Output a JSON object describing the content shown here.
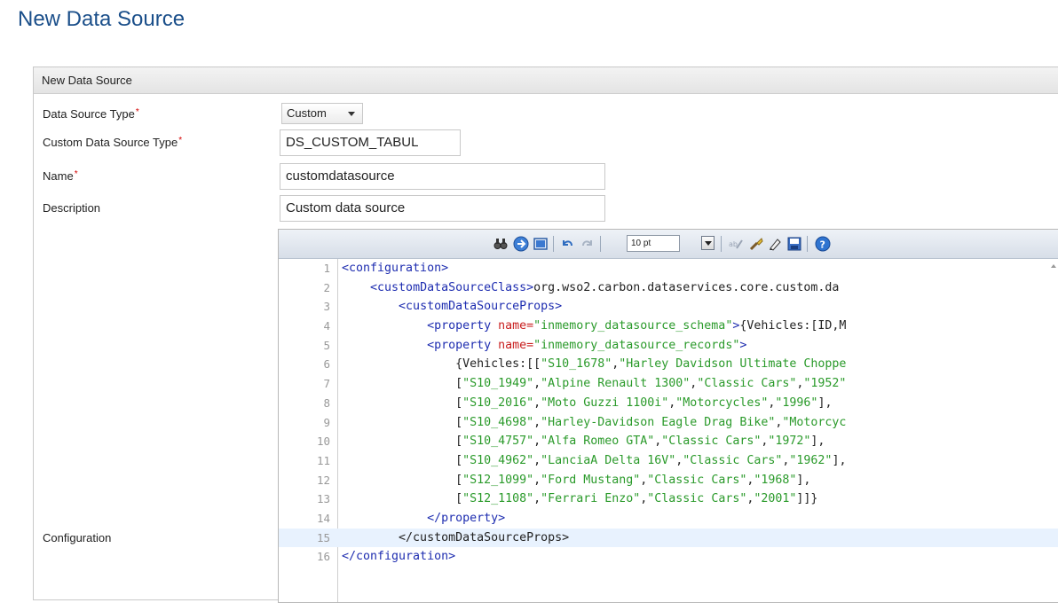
{
  "page_title": "New Data Source",
  "panel": {
    "header": "New Data Source",
    "required_marker": "*",
    "fields": {
      "type": {
        "label": "Data Source Type",
        "value": "Custom"
      },
      "custom_type": {
        "label": "Custom Data Source Type",
        "value": "DS_CUSTOM_TABUL"
      },
      "name": {
        "label": "Name",
        "value": "customdatasource"
      },
      "description": {
        "label": "Description",
        "value": "Custom data source"
      },
      "configuration": {
        "label": "Configuration"
      }
    }
  },
  "editor": {
    "font_size": "10 pt",
    "toolbar_icons": [
      "search-icon",
      "goto-icon",
      "fullscreen-icon",
      "undo-icon",
      "redo-icon",
      "font-size-select",
      "autocomplete-icon",
      "reformat-icon",
      "highlight-icon",
      "save-icon",
      "help-icon"
    ],
    "lines": [
      {
        "num": "1",
        "tokens": [
          {
            "t": "<configuration>",
            "c": "tag"
          }
        ]
      },
      {
        "num": "2",
        "tokens": [
          {
            "t": "    ",
            "c": "txt"
          },
          {
            "t": "<customDataSourceClass>",
            "c": "tag"
          },
          {
            "t": "org.wso2.carbon.dataservices.core.custom.da",
            "c": "txt"
          }
        ]
      },
      {
        "num": "3",
        "tokens": [
          {
            "t": "        ",
            "c": "txt"
          },
          {
            "t": "<customDataSourceProps>",
            "c": "tag"
          }
        ]
      },
      {
        "num": "4",
        "tokens": [
          {
            "t": "            ",
            "c": "txt"
          },
          {
            "t": "<property ",
            "c": "tag"
          },
          {
            "t": "name=",
            "c": "attr"
          },
          {
            "t": "\"inmemory_datasource_schema\"",
            "c": "str"
          },
          {
            "t": ">",
            "c": "tag"
          },
          {
            "t": "{Vehicles:[ID,M",
            "c": "txt"
          }
        ]
      },
      {
        "num": "5",
        "tokens": [
          {
            "t": "            ",
            "c": "txt"
          },
          {
            "t": "<property ",
            "c": "tag"
          },
          {
            "t": "name=",
            "c": "attr"
          },
          {
            "t": "\"inmemory_datasource_records\"",
            "c": "str"
          },
          {
            "t": ">",
            "c": "tag"
          }
        ]
      },
      {
        "num": "6",
        "tokens": [
          {
            "t": "                {Vehicles:[[",
            "c": "txt"
          },
          {
            "t": "\"S10_1678\"",
            "c": "str"
          },
          {
            "t": ",",
            "c": "txt"
          },
          {
            "t": "\"Harley Davidson Ultimate Choppe",
            "c": "str"
          }
        ]
      },
      {
        "num": "7",
        "tokens": [
          {
            "t": "                [",
            "c": "txt"
          },
          {
            "t": "\"S10_1949\"",
            "c": "str"
          },
          {
            "t": ",",
            "c": "txt"
          },
          {
            "t": "\"Alpine Renault 1300\"",
            "c": "str"
          },
          {
            "t": ",",
            "c": "txt"
          },
          {
            "t": "\"Classic Cars\"",
            "c": "str"
          },
          {
            "t": ",",
            "c": "txt"
          },
          {
            "t": "\"1952\"",
            "c": "str"
          }
        ]
      },
      {
        "num": "8",
        "tokens": [
          {
            "t": "                [",
            "c": "txt"
          },
          {
            "t": "\"S10_2016\"",
            "c": "str"
          },
          {
            "t": ",",
            "c": "txt"
          },
          {
            "t": "\"Moto Guzzi 1100i\"",
            "c": "str"
          },
          {
            "t": ",",
            "c": "txt"
          },
          {
            "t": "\"Motorcycles\"",
            "c": "str"
          },
          {
            "t": ",",
            "c": "txt"
          },
          {
            "t": "\"1996\"",
            "c": "str"
          },
          {
            "t": "],",
            "c": "txt"
          }
        ]
      },
      {
        "num": "9",
        "tokens": [
          {
            "t": "                [",
            "c": "txt"
          },
          {
            "t": "\"S10_4698\"",
            "c": "str"
          },
          {
            "t": ",",
            "c": "txt"
          },
          {
            "t": "\"Harley-Davidson Eagle Drag Bike\"",
            "c": "str"
          },
          {
            "t": ",",
            "c": "txt"
          },
          {
            "t": "\"Motorcyc",
            "c": "str"
          }
        ]
      },
      {
        "num": "10",
        "tokens": [
          {
            "t": "                [",
            "c": "txt"
          },
          {
            "t": "\"S10_4757\"",
            "c": "str"
          },
          {
            "t": ",",
            "c": "txt"
          },
          {
            "t": "\"Alfa Romeo GTA\"",
            "c": "str"
          },
          {
            "t": ",",
            "c": "txt"
          },
          {
            "t": "\"Classic Cars\"",
            "c": "str"
          },
          {
            "t": ",",
            "c": "txt"
          },
          {
            "t": "\"1972\"",
            "c": "str"
          },
          {
            "t": "],",
            "c": "txt"
          }
        ]
      },
      {
        "num": "11",
        "tokens": [
          {
            "t": "                [",
            "c": "txt"
          },
          {
            "t": "\"S10_4962\"",
            "c": "str"
          },
          {
            "t": ",",
            "c": "txt"
          },
          {
            "t": "\"LanciaA Delta 16V\"",
            "c": "str"
          },
          {
            "t": ",",
            "c": "txt"
          },
          {
            "t": "\"Classic Cars\"",
            "c": "str"
          },
          {
            "t": ",",
            "c": "txt"
          },
          {
            "t": "\"1962\"",
            "c": "str"
          },
          {
            "t": "],",
            "c": "txt"
          }
        ]
      },
      {
        "num": "12",
        "tokens": [
          {
            "t": "                [",
            "c": "txt"
          },
          {
            "t": "\"S12_1099\"",
            "c": "str"
          },
          {
            "t": ",",
            "c": "txt"
          },
          {
            "t": "\"Ford Mustang\"",
            "c": "str"
          },
          {
            "t": ",",
            "c": "txt"
          },
          {
            "t": "\"Classic Cars\"",
            "c": "str"
          },
          {
            "t": ",",
            "c": "txt"
          },
          {
            "t": "\"1968\"",
            "c": "str"
          },
          {
            "t": "],",
            "c": "txt"
          }
        ]
      },
      {
        "num": "13",
        "tokens": [
          {
            "t": "                [",
            "c": "txt"
          },
          {
            "t": "\"S12_1108\"",
            "c": "str"
          },
          {
            "t": ",",
            "c": "txt"
          },
          {
            "t": "\"Ferrari Enzo\"",
            "c": "str"
          },
          {
            "t": ",",
            "c": "txt"
          },
          {
            "t": "\"Classic Cars\"",
            "c": "str"
          },
          {
            "t": ",",
            "c": "txt"
          },
          {
            "t": "\"2001\"",
            "c": "str"
          },
          {
            "t": "]]}",
            "c": "txt"
          }
        ]
      },
      {
        "num": "14",
        "tokens": [
          {
            "t": "            ",
            "c": "txt"
          },
          {
            "t": "</property>",
            "c": "tag"
          }
        ]
      },
      {
        "num": "15",
        "tokens": [
          {
            "t": "        </customDataSourceProps>",
            "c": "txt"
          }
        ]
      },
      {
        "num": "16",
        "tokens": [
          {
            "t": "</configuration>",
            "c": "tag"
          }
        ]
      }
    ]
  }
}
